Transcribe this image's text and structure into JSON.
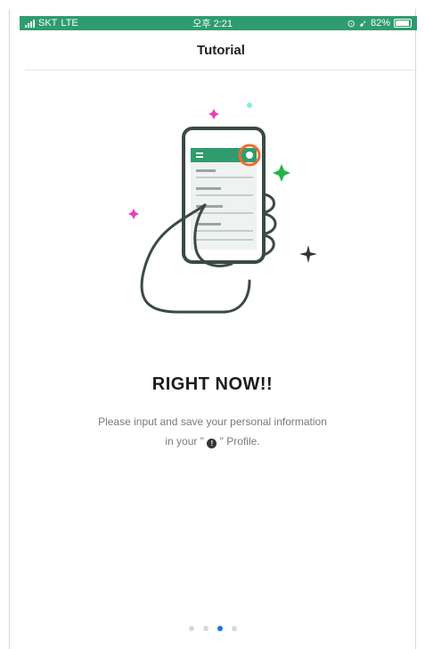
{
  "status_bar": {
    "carrier": "SKT",
    "network": "LTE",
    "time": "오후 2:21",
    "battery": "82%",
    "battery_level": 0.82
  },
  "nav": {
    "title": "Tutorial"
  },
  "illustration": {
    "description_icons": [
      "hand-holding-phone-icon",
      "profile-info-icon",
      "sparkle-icon"
    ],
    "colors": {
      "accent_green": "#2f9c6e",
      "highlight_orange": "#f26a2e",
      "sparkle_pink": "#e83fb7",
      "sparkle_cyan": "#8de6e0"
    }
  },
  "content": {
    "headline": "RIGHT NOW!!",
    "line1": "Please input and save your personal information",
    "line2_prefix": "in your \"",
    "line2_icon": "!",
    "line2_suffix": "\" Profile."
  },
  "pagination": {
    "total": 4,
    "current": 3
  }
}
